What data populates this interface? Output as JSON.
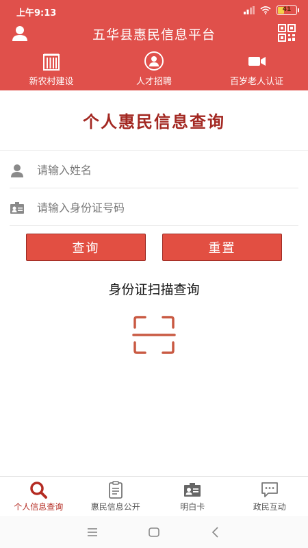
{
  "status": {
    "time": "上午9:13",
    "battery": "41"
  },
  "header": {
    "title": "五华县惠民信息平台",
    "quick_nav": [
      {
        "label": "新农村建设",
        "icon": "building-icon"
      },
      {
        "label": "人才招聘",
        "icon": "talent-icon"
      },
      {
        "label": "百岁老人认证",
        "icon": "video-camera-icon"
      }
    ]
  },
  "main": {
    "title": "个人惠民信息查询",
    "name_input": {
      "placeholder": "请输入姓名",
      "value": ""
    },
    "id_input": {
      "placeholder": "请输入身份证号码",
      "value": ""
    },
    "query_button": "查询",
    "reset_button": "重置",
    "scan_label": "身份证扫描查询"
  },
  "tabs": [
    {
      "label": "个人信息查询",
      "icon": "search-icon",
      "active": true
    },
    {
      "label": "惠民信息公开",
      "icon": "clipboard-icon",
      "active": false
    },
    {
      "label": "明白卡",
      "icon": "id-card-icon",
      "active": false
    },
    {
      "label": "政民互动",
      "icon": "chat-icon",
      "active": false
    }
  ],
  "colors": {
    "header_bg": "#e0504b",
    "title_red": "#a32822",
    "button_red": "#e24f42",
    "active_tab": "#b42b22"
  }
}
